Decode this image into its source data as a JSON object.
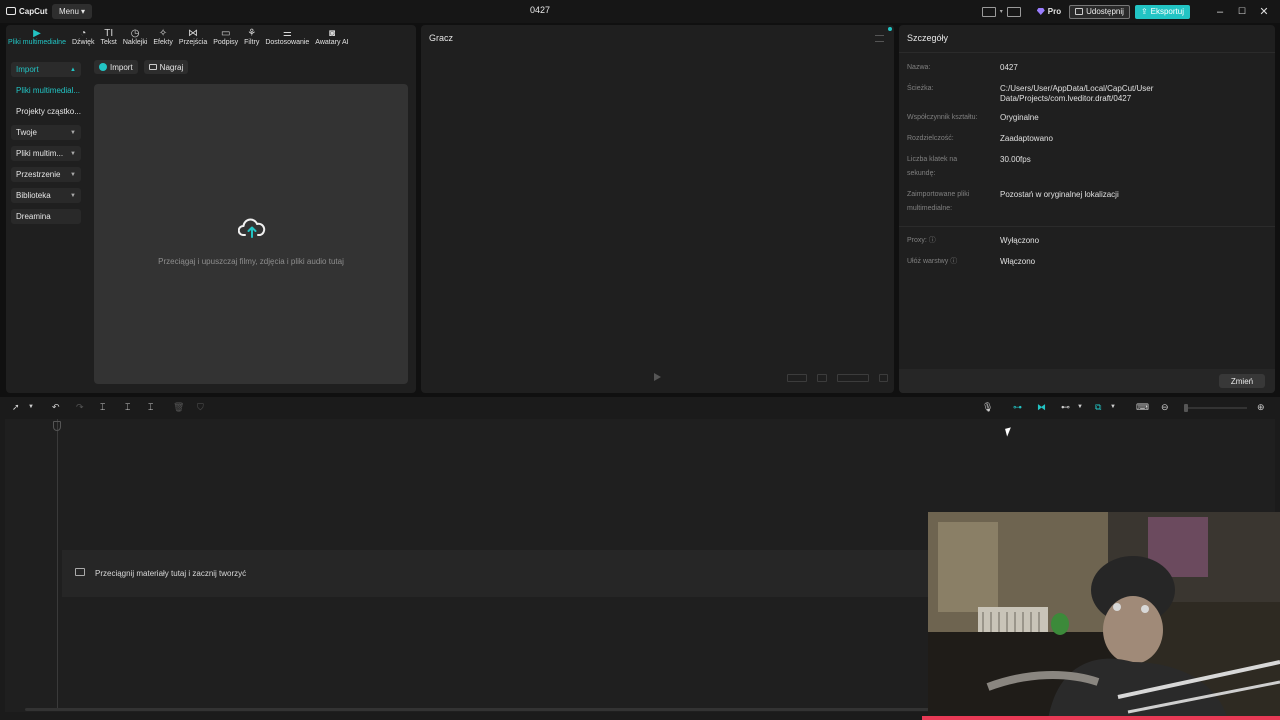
{
  "app": {
    "logo_text": "CapCut",
    "menu_label": "Menu",
    "project_title": "0427",
    "pro_label": "Pro",
    "share_label": "Udostępnij",
    "export_label": "Eksportuj",
    "accent_color": "#22c4c4"
  },
  "tools": [
    {
      "label": "Pliki multimedialne",
      "icon": "media-icon",
      "active": true
    },
    {
      "label": "Dźwięk",
      "icon": "audio-icon"
    },
    {
      "label": "Tekst",
      "icon": "text-icon"
    },
    {
      "label": "Naklejki",
      "icon": "sticker-icon"
    },
    {
      "label": "Efekty",
      "icon": "effects-icon"
    },
    {
      "label": "Przejścia",
      "icon": "transitions-icon"
    },
    {
      "label": "Podpisy",
      "icon": "captions-icon"
    },
    {
      "label": "Filtry",
      "icon": "filters-icon"
    },
    {
      "label": "Dostosowanie",
      "icon": "adjust-icon"
    },
    {
      "label": "Awatary AI",
      "icon": "avatar-icon"
    }
  ],
  "sidebar": {
    "items": [
      {
        "label": "Import"
      },
      {
        "label": "Pliki multimedial..."
      },
      {
        "label": "Projekty cząstko..."
      },
      {
        "label": "Twoje"
      },
      {
        "label": "Pliki multim..."
      },
      {
        "label": "Przestrzenie"
      },
      {
        "label": "Biblioteka"
      },
      {
        "label": "Dreamina"
      }
    ]
  },
  "media": {
    "import_label": "Import",
    "record_label": "Nagraj",
    "drop_text": "Przeciągaj i upuszczaj filmy, zdjęcia i pliki audio tutaj"
  },
  "player": {
    "title": "Gracz"
  },
  "details": {
    "title": "Szczegóły",
    "rows": [
      {
        "key": "Nazwa:",
        "value": "0427"
      },
      {
        "key": "Ścieżka:",
        "value": "C:/Users/User/AppData/Local/CapCut/User Data/Projects/com.lveditor.draft/0427"
      },
      {
        "key": "Współczynnik kształtu:",
        "value": "Oryginalne"
      },
      {
        "key": "Rozdzielczość:",
        "value": "Zaadaptowano"
      },
      {
        "key": "Liczba klatek na sekundę:",
        "value": "30.00fps"
      },
      {
        "key": "Zaimportowane pliki multimedialne:",
        "value": "Pozostań w oryginalnej lokalizacji"
      },
      {
        "key": "Proxy:",
        "value": "Wyłączono"
      },
      {
        "key": "Ułóż warstwy",
        "value": "Włączono"
      }
    ],
    "change_label": "Zmień"
  },
  "timeline": {
    "drop_text": "Przeciągnij materiały tutaj i zacznij tworzyć"
  }
}
